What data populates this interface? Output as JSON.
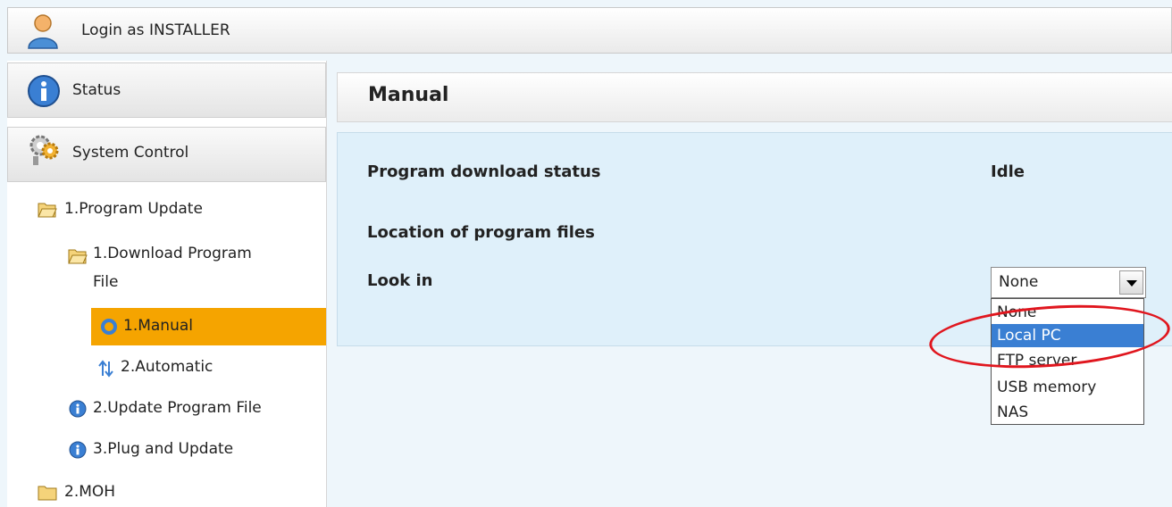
{
  "header": {
    "login_text": "Login as INSTALLER",
    "icon": "user-icon"
  },
  "sidebar": {
    "status_label": "Status",
    "system_control_label": "System Control",
    "tree": {
      "program_update": "1.Program Update",
      "download_program_file_line1": "1.Download Program",
      "download_program_file_line2": "File",
      "manual": "1.Manual",
      "automatic": "2.Automatic",
      "update_program_file": "2.Update Program File",
      "plug_and_update": "3.Plug and Update",
      "moh": "2.MOH"
    }
  },
  "main": {
    "title": "Manual",
    "program_download_status_label": "Program download status",
    "program_download_status_value": "Idle",
    "location_label": "Location of program files",
    "look_in_label": "Look in",
    "look_in_selected": "None",
    "look_in_options": [
      "None",
      "Local PC",
      "FTP server",
      "USB memory",
      "NAS"
    ],
    "highlighted_option": "Local PC"
  },
  "colors": {
    "selected_bg": "#f5a400",
    "option_highlight": "#3a7fd3",
    "annotation": "#e0161e",
    "panel_bg": "#dff0fa"
  }
}
